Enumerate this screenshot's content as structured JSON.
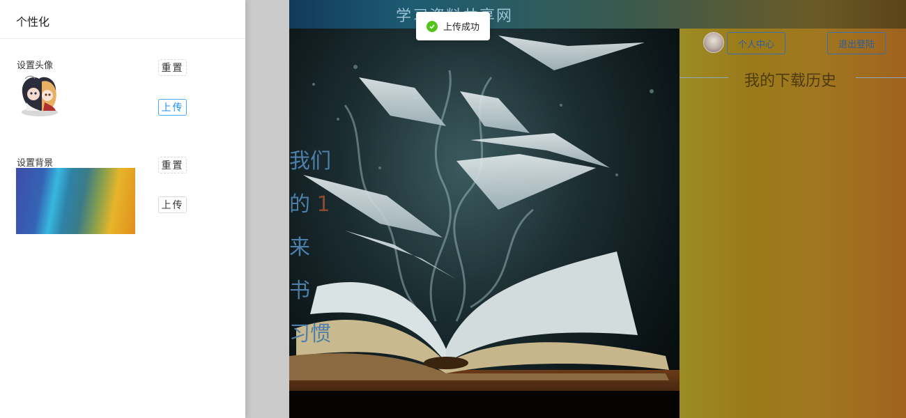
{
  "site": {
    "title": "学习资料共享网"
  },
  "hero": {
    "slogan": [
      "我们",
      "的",
      "1",
      "来",
      "书",
      "习惯"
    ]
  },
  "header": {
    "center_label": "个人中心",
    "logout_label": "退出登陆"
  },
  "history": {
    "title": "我的下载历史"
  },
  "drawer": {
    "title": "个性化",
    "avatar_label": "设置头像",
    "bg_label": "设置背景",
    "reset_label": "重置",
    "upload_label": "上传"
  },
  "toast": {
    "text": "上传成功",
    "icon": "check-circle-icon",
    "color": "#52c41a"
  },
  "colors": {
    "accent": "#1890ff",
    "header_btn": "#2c5f9e"
  }
}
